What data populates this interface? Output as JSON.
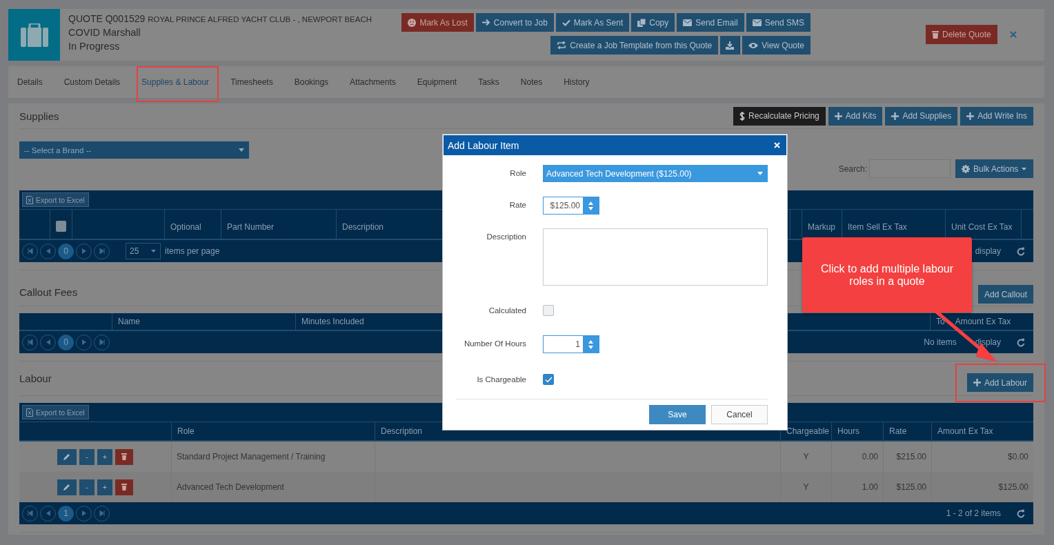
{
  "header": {
    "code": "QUOTE Q001529",
    "client": "ROYAL PRINCE ALFRED YACHT CLUB - , NEWPORT BEACH",
    "name": "COVID Marshall",
    "status": "In Progress"
  },
  "actions_row1": [
    {
      "label": "Mark As Lost",
      "kind": "danger"
    },
    {
      "label": "Convert to Job",
      "kind": "primary"
    },
    {
      "label": "Mark As Sent",
      "kind": "primary"
    },
    {
      "label": "Copy",
      "kind": "primary"
    },
    {
      "label": "Send Email",
      "kind": "primary"
    },
    {
      "label": "Send SMS",
      "kind": "primary"
    }
  ],
  "actions_row2": [
    {
      "label": "Create a Job Template from this Quote",
      "kind": "primary"
    },
    {
      "kind": "primary"
    },
    {
      "label": "View Quote",
      "kind": "primary"
    }
  ],
  "delete_button": "Delete Quote",
  "tabs": [
    {
      "label": "Details",
      "selected": false,
      "highlighted": false
    },
    {
      "label": "Custom Details",
      "selected": false,
      "highlighted": false
    },
    {
      "label": "Supplies & Labour",
      "selected": true,
      "highlighted": true
    },
    {
      "label": "Timesheets",
      "selected": false,
      "highlighted": false
    },
    {
      "label": "Bookings",
      "selected": false,
      "highlighted": false
    },
    {
      "label": "Attachments",
      "selected": false,
      "highlighted": false
    },
    {
      "label": "Equipment",
      "selected": false,
      "highlighted": false
    },
    {
      "label": "Tasks",
      "selected": false,
      "highlighted": false
    },
    {
      "label": "Notes",
      "selected": false,
      "highlighted": false
    },
    {
      "label": "History",
      "selected": false,
      "highlighted": false
    }
  ],
  "supplies": {
    "title": "Supplies",
    "toolbar": [
      {
        "label": "Recalculate Pricing",
        "kind": "dark"
      },
      {
        "label": "Add Kits",
        "kind": "primary"
      },
      {
        "label": "Add Supplies",
        "kind": "primary"
      },
      {
        "label": "Add Write Ins",
        "kind": "primary"
      }
    ],
    "select_all_checked": false,
    "brand_select": "-- Select a Brand --",
    "search_label": "Search:",
    "bulk_actions": "Bulk Actions",
    "export": "Export to Excel",
    "columns": [
      "Optional",
      "Part Number",
      "Description",
      "Markup",
      "Item Sell Ex Tax",
      "Unit Cost Ex Tax"
    ],
    "pager": {
      "page": "0",
      "page_size": "25",
      "page_size_label": "items per page",
      "summary": "display"
    }
  },
  "callout_fees": {
    "title": "Callout Fees",
    "add_button": "Add Callout",
    "columns": [
      "Name",
      "Minutes Included"
    ],
    "last_column_parts": [
      "To",
      "Amount Ex Tax"
    ],
    "pager": {
      "page": "0",
      "summary_parts": [
        "No items",
        "display"
      ]
    }
  },
  "labour": {
    "title": "Labour",
    "add_button": "Add Labour",
    "add_highlighted": true,
    "export": "Export to Excel",
    "columns": [
      "Role",
      "Description",
      "Chargeable",
      "Hours",
      "Rate",
      "Amount Ex Tax"
    ],
    "rows": [
      {
        "minus": "-",
        "plus": "+",
        "role": "Standard Project Management / Training",
        "chargeable": "Y",
        "hours": "0.00",
        "rate": "$215.00",
        "amount": "$0.00"
      },
      {
        "minus": "-",
        "plus": "+",
        "role": "Advanced Tech Development",
        "chargeable": "Y",
        "hours": "1.00",
        "rate": "$125.00",
        "amount": "$125.00"
      }
    ],
    "pager": {
      "page": "1",
      "summary": "1 - 2 of 2 items"
    }
  },
  "modal": {
    "title": "Add Labour Item",
    "fields": [
      {
        "kind": "select",
        "label": "Role",
        "value": "Advanced Tech Development ($125.00)"
      },
      {
        "kind": "spinner",
        "label": "Rate",
        "value": "$125.00"
      },
      {
        "kind": "textarea",
        "label": "Description"
      },
      {
        "kind": "checkbox",
        "label": "Calculated",
        "checked": false
      },
      {
        "kind": "spinner",
        "label": "Number Of Hours",
        "value": "1"
      },
      {
        "kind": "checkbox",
        "label": "Is Chargeable",
        "checked": true
      }
    ],
    "save": "Save",
    "cancel": "Cancel"
  },
  "callout": {
    "text": "Click to add multiple labour roles in a quote"
  }
}
